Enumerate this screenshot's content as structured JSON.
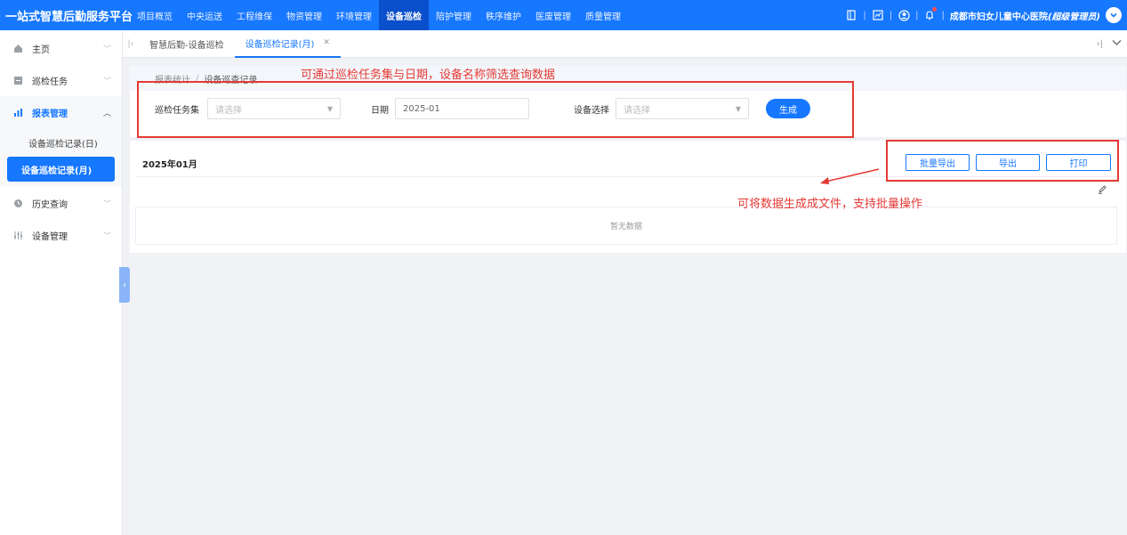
{
  "brand": "一站式智慧后勤服务平台",
  "topnav": [
    {
      "label": "项目概览",
      "active": false
    },
    {
      "label": "中央运送",
      "active": false
    },
    {
      "label": "工程维保",
      "active": false
    },
    {
      "label": "物资管理",
      "active": false
    },
    {
      "label": "环境管理",
      "active": false
    },
    {
      "label": "设备巡检",
      "active": true
    },
    {
      "label": "陪护管理",
      "active": false
    },
    {
      "label": "秩序维护",
      "active": false
    },
    {
      "label": "医废管理",
      "active": false
    },
    {
      "label": "质量管理",
      "active": false
    }
  ],
  "user": {
    "org": "成都市妇女儿童中心医院",
    "role": "(超级管理员)"
  },
  "sidebar": {
    "home": "主页",
    "inspection_task": "巡检任务",
    "report_mgmt": "报表管理",
    "report_daily": "设备巡检记录(日)",
    "report_monthly": "设备巡检记录(月)",
    "history": "历史查询",
    "device_mgmt": "设备管理"
  },
  "tabs": [
    {
      "label": "智慧后勤-设备巡检",
      "active": false
    },
    {
      "label": "设备巡检记录(月)",
      "active": true
    }
  ],
  "breadcrumb": {
    "parent": "报表统计",
    "separator": "/",
    "current": "设备巡查记录"
  },
  "filters": {
    "task_set_label": "巡检任务集",
    "task_set_placeholder": "请选择",
    "date_label": "日期",
    "date_value": "2025-01",
    "device_label": "设备选择",
    "device_placeholder": "请选择",
    "generate_label": "生成"
  },
  "result": {
    "title": "2025年01月",
    "batch_export": "批量导出",
    "export": "导出",
    "print": "打印",
    "empty_text": "暂无数据"
  },
  "annotations": {
    "filter_note": "可通过巡检任务集与日期，设备名称筛选查询数据",
    "action_note": "可将数据生成成文件，支持批量操作"
  },
  "colors": {
    "primary": "#1677ff",
    "annotation": "#e53935"
  }
}
